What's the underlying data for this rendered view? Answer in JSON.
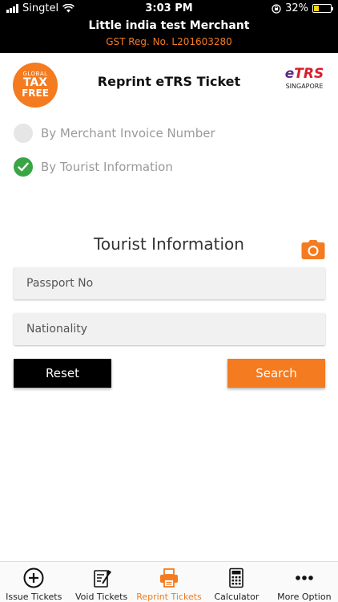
{
  "status": {
    "carrier": "Singtel",
    "time": "3:03 PM",
    "battery": "32%",
    "battery_level": 0.32
  },
  "merchant": {
    "name": "Little india test Merchant",
    "gst": "GST Reg. No. L201603280"
  },
  "header": {
    "title": "Reprint eTRS Ticket",
    "logo_left": {
      "line1": "GLOBAL",
      "line2": "TAX",
      "line3": "FREE"
    },
    "logo_right": {
      "brand_e": "e",
      "brand_rest": "TRS",
      "sub": "SINGAPORE"
    }
  },
  "options": [
    {
      "label": "By Merchant Invoice Number",
      "selected": false
    },
    {
      "label": "By Tourist Information",
      "selected": true
    }
  ],
  "form": {
    "title": "Tourist Information",
    "passport_placeholder": "Passport No",
    "nationality_placeholder": "Nationality",
    "reset_label": "Reset",
    "search_label": "Search"
  },
  "tabs": [
    {
      "label": "Issue Tickets",
      "icon": "plus-circle-icon"
    },
    {
      "label": "Void Tickets",
      "icon": "void-ticket-icon"
    },
    {
      "label": "Reprint Tickets",
      "icon": "printer-icon",
      "active": true
    },
    {
      "label": "Calculator",
      "icon": "calculator-icon"
    },
    {
      "label": "More Option",
      "icon": "more-dots-icon"
    }
  ],
  "colors": {
    "accent": "#f47b20",
    "check": "#3aa544",
    "dark": "#000000"
  }
}
